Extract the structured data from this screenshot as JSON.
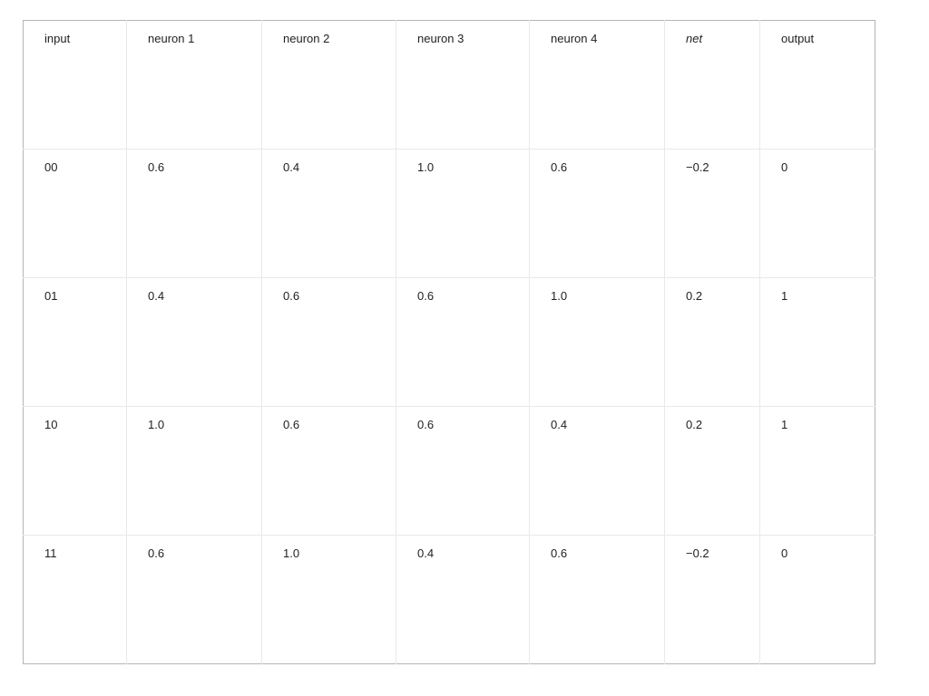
{
  "table": {
    "columns": [
      {
        "key": "input",
        "label": "input",
        "italic": false
      },
      {
        "key": "n1",
        "label": "neuron 1",
        "italic": false
      },
      {
        "key": "n2",
        "label": "neuron 2",
        "italic": false
      },
      {
        "key": "n3",
        "label": "neuron 3",
        "italic": false
      },
      {
        "key": "n4",
        "label": "neuron 4",
        "italic": false
      },
      {
        "key": "net",
        "label": "net",
        "italic": true
      },
      {
        "key": "output",
        "label": "output",
        "italic": false
      }
    ],
    "headers": {
      "input": "input",
      "neuron_1": "neuron 1",
      "neuron_2": "neuron 2",
      "neuron_3": "neuron 3",
      "neuron_4": "neuron 4",
      "net": "net",
      "output": "output"
    },
    "rows": [
      {
        "input": "00",
        "neuron_1": "0.6",
        "neuron_2": "0.4",
        "neuron_3": "1.0",
        "neuron_4": "0.6",
        "net": "−0.2",
        "output": "0"
      },
      {
        "input": "01",
        "neuron_1": "0.4",
        "neuron_2": "0.6",
        "neuron_3": "0.6",
        "neuron_4": "1.0",
        "net": "0.2",
        "output": "1"
      },
      {
        "input": "10",
        "neuron_1": "1.0",
        "neuron_2": "0.6",
        "neuron_3": "0.6",
        "neuron_4": "0.4",
        "net": "0.2",
        "output": "1"
      },
      {
        "input": "11",
        "neuron_1": "0.6",
        "neuron_2": "1.0",
        "neuron_3": "0.4",
        "neuron_4": "0.6",
        "net": "−0.2",
        "output": "0"
      }
    ],
    "colors": {
      "outer_border": "#b5b5b5",
      "inner_border": "#e9e9e9",
      "text": "#1f1f1f",
      "background": "#ffffff"
    }
  }
}
